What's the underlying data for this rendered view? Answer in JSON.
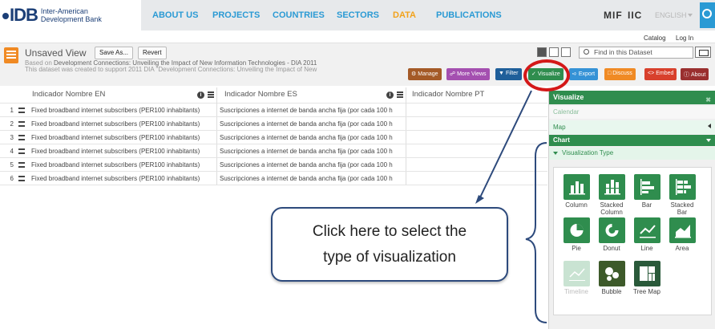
{
  "brand": {
    "mark": "IDB",
    "name_line1": "Inter-American",
    "name_line2": "Development Bank"
  },
  "nav": [
    "ABOUT US",
    "PROJECTS",
    "COUNTRIES",
    "SECTORS",
    "DATA",
    "PUBLICATIONS"
  ],
  "nav_active": "DATA",
  "partners": {
    "mif": "MIF",
    "iic": "IIC"
  },
  "language": "ENGLISH",
  "subnav": {
    "catalog": "Catalog",
    "login": "Log In"
  },
  "dataset": {
    "title": "Unsaved View",
    "save_as": "Save As...",
    "revert": "Revert",
    "based_on_prefix": "Based on ",
    "based_on_name": "Development Connections: Unveiling the Impact of New Information Technologies - DIA 2011",
    "description": "This dataset was created to support 2011 DIA \"Development Connections: Unveiling the Impact of New",
    "find_placeholder": "Find in this Dataset"
  },
  "toolbar": [
    {
      "label": "Manage",
      "color": "#a45a27"
    },
    {
      "label": "More Views",
      "color": "#a44fb0"
    },
    {
      "label": "Filter",
      "color": "#1f5f9a"
    },
    {
      "label": "Visualize",
      "color": "#2f8d4e"
    },
    {
      "label": "Export",
      "color": "#3592d6"
    },
    {
      "label": "Discuss",
      "color": "#f08a24"
    },
    {
      "label": "Embed",
      "color": "#d8402c"
    },
    {
      "label": "About",
      "color": "#9a2f2f"
    }
  ],
  "grid": {
    "columns": [
      "Indicador Nombre EN",
      "Indicador Nombre ES",
      "Indicador Nombre PT"
    ],
    "rows": [
      {
        "n": "1",
        "en": "Fixed broadband internet subscribers (PER100 inhabitants)",
        "es": "Suscripciones a internet de banda ancha fija (por cada 100 h"
      },
      {
        "n": "2",
        "en": "Fixed broadband internet subscribers (PER100 inhabitants)",
        "es": "Suscripciones a internet de banda ancha fija (por cada 100 h"
      },
      {
        "n": "3",
        "en": "Fixed broadband internet subscribers (PER100 inhabitants)",
        "es": "Suscripciones a internet de banda ancha fija (por cada 100 h"
      },
      {
        "n": "4",
        "en": "Fixed broadband internet subscribers (PER100 inhabitants)",
        "es": "Suscripciones a internet de banda ancha fija (por cada 100 h"
      },
      {
        "n": "5",
        "en": "Fixed broadband internet subscribers (PER100 inhabitants)",
        "es": "Suscripciones a internet de banda ancha fija (por cada 100 h"
      },
      {
        "n": "6",
        "en": "Fixed broadband internet subscribers (PER100 inhabitants)",
        "es": "Suscripciones a internet de banda ancha fija (por cada 100 h"
      }
    ]
  },
  "callout": {
    "line1": "Click here to select the",
    "line2": "type of visualization"
  },
  "panel": {
    "title": "Visualize",
    "calendar": "Calendar",
    "map": "Map",
    "chart": "Chart",
    "viz_type": "Visualization Type",
    "types": [
      {
        "line1": "Column",
        "line2": "",
        "icon": "column-chart-icon",
        "enabled": true
      },
      {
        "line1": "Stacked",
        "line2": "Column",
        "icon": "stacked-column-icon",
        "enabled": true
      },
      {
        "line1": "Bar",
        "line2": "",
        "icon": "bar-chart-icon",
        "enabled": true
      },
      {
        "line1": "Stacked",
        "line2": "Bar",
        "icon": "stacked-bar-icon",
        "enabled": true
      },
      {
        "line1": "Pie",
        "line2": "",
        "icon": "pie-chart-icon",
        "enabled": true
      },
      {
        "line1": "Donut",
        "line2": "",
        "icon": "donut-chart-icon",
        "enabled": true
      },
      {
        "line1": "Line",
        "line2": "",
        "icon": "line-chart-icon",
        "enabled": true
      },
      {
        "line1": "Area",
        "line2": "",
        "icon": "area-chart-icon",
        "enabled": true
      },
      {
        "line1": "Timeline",
        "line2": "",
        "icon": "timeline-icon",
        "enabled": false
      },
      {
        "line1": "Bubble",
        "line2": "",
        "icon": "bubble-chart-icon",
        "enabled": true
      },
      {
        "line1": "Tree Map",
        "line2": "",
        "icon": "tree-map-icon",
        "enabled": true
      }
    ]
  }
}
